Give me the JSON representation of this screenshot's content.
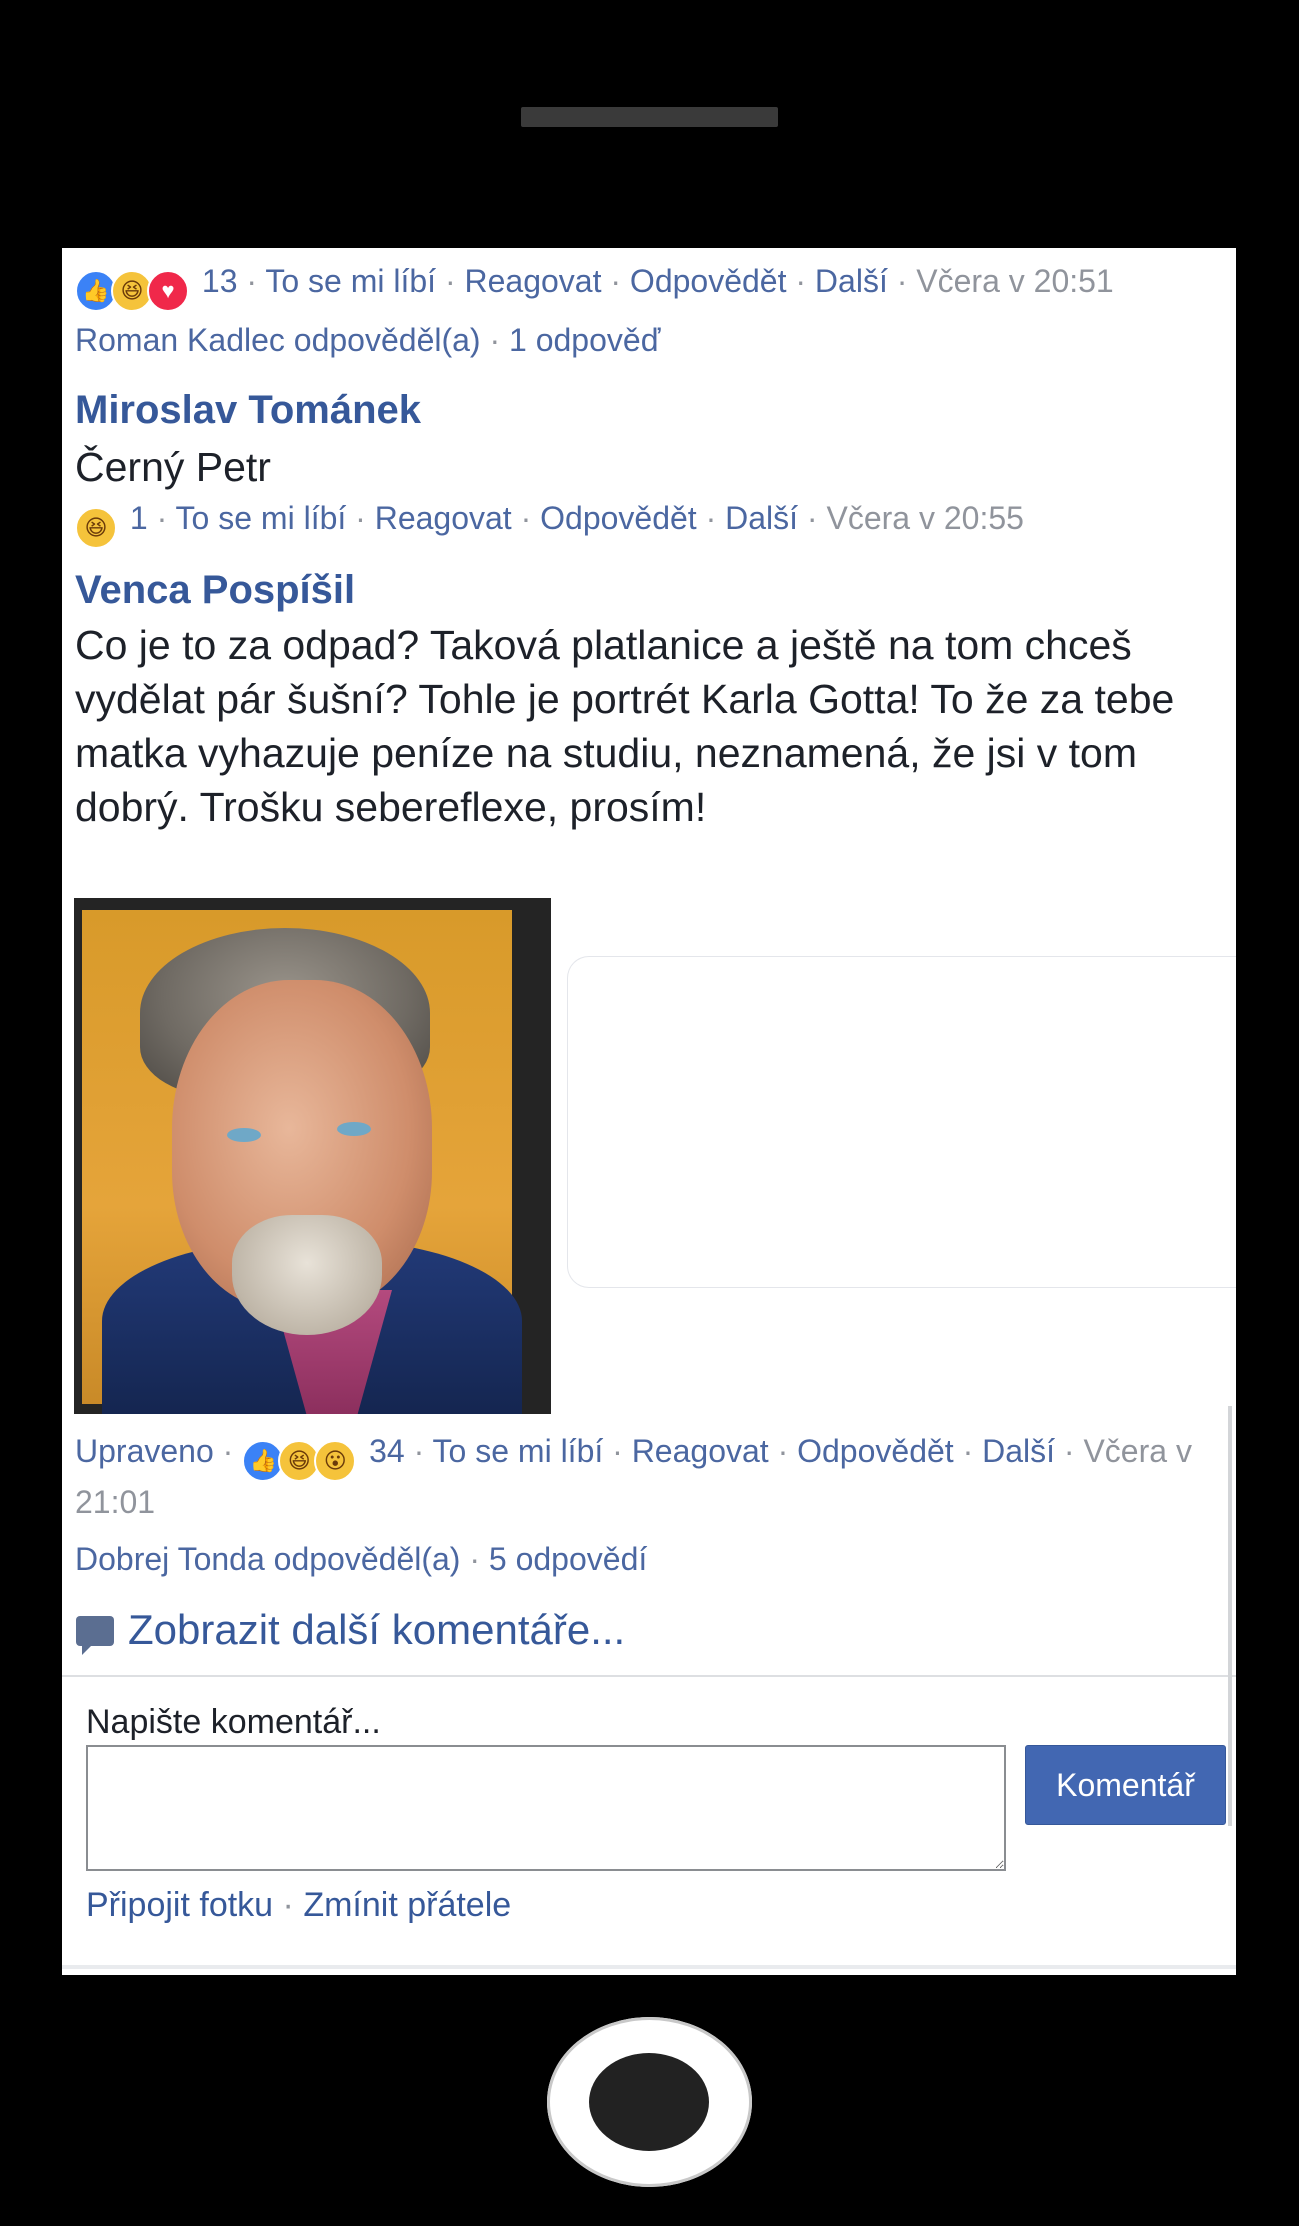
{
  "comment1": {
    "reactions": [
      "like",
      "haha",
      "love"
    ],
    "count": "13",
    "like": "To se mi líbí",
    "react": "Reagovat",
    "reply": "Odpovědět",
    "more": "Další",
    "time": "Včera v 20:51",
    "replies_summary": "Roman Kadlec odpověděl(a)",
    "replies_count": "1 odpověď"
  },
  "comment2": {
    "author": "Miroslav Tománek",
    "text": "Černý Petr",
    "reactions": [
      "haha"
    ],
    "count": "1",
    "like": "To se mi líbí",
    "react": "Reagovat",
    "reply": "Odpovědět",
    "more": "Další",
    "time": "Včera v 20:55"
  },
  "comment3": {
    "author": "Venca Pospíšil",
    "text": "Co je to za odpad? Taková platlanice a ještě na tom chceš vydělat pár šušní? Tohle je portrét Karla Gotta! To že za tebe matka vyhazuje peníze na studiu, neznamená, že jsi v tom dobrý. Trošku sebereflexe, prosím!",
    "edited": "Upraveno",
    "reactions": [
      "like",
      "haha",
      "wow"
    ],
    "count": "34",
    "like": "To se mi líbí",
    "react": "Reagovat",
    "reply": "Odpovědět",
    "more": "Další",
    "time_part1": "Včera v",
    "time_part2": "21:01",
    "replies_summary": "Dobrej Tonda odpověděl(a)",
    "replies_count": "5 odpovědí"
  },
  "more_comments": "Zobrazit další komentáře...",
  "composer": {
    "label": "Napište komentář...",
    "value": "",
    "button": "Komentář",
    "attach_photo": "Připojit fotku",
    "mention": "Zmínit přátele"
  },
  "icons": {
    "like": "thumbs-up-icon",
    "haha": "laughing-face-icon",
    "love": "heart-icon",
    "wow": "surprised-face-icon",
    "more_comments": "comment-bubble-icon"
  },
  "colors": {
    "link": "#365899",
    "meta_link": "#4b67a1",
    "muted": "#90949c",
    "button": "#4267b2"
  }
}
